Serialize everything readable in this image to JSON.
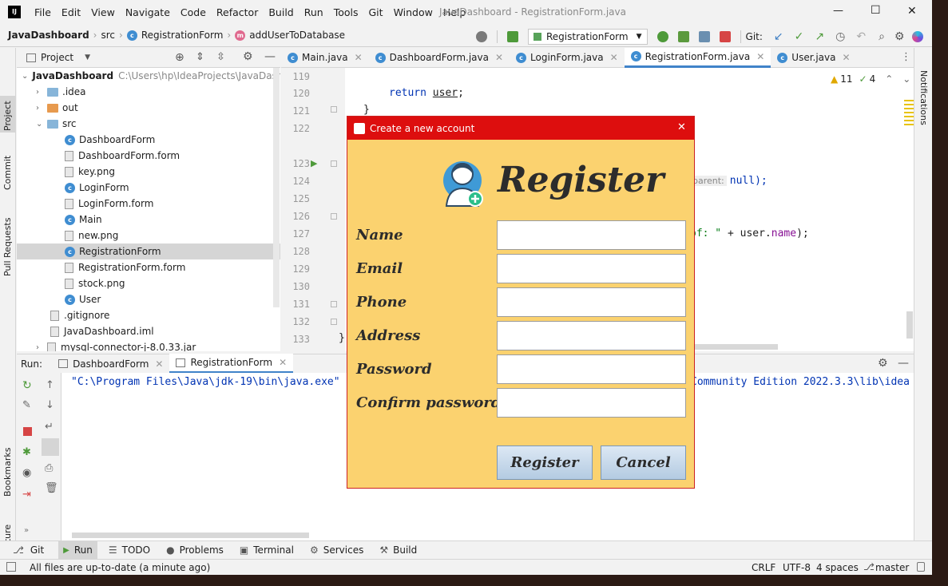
{
  "window": {
    "title": "JavaDashboard - RegistrationForm.java",
    "logo_text": "IJ",
    "menu": [
      "File",
      "Edit",
      "View",
      "Navigate",
      "Code",
      "Refactor",
      "Build",
      "Run",
      "Tools",
      "Git",
      "Window",
      "Help"
    ],
    "minimize": "—",
    "maximize": "☐",
    "close": "✕"
  },
  "breadcrumb": {
    "project": "JavaDashboard",
    "folder": "src",
    "class": "RegistrationForm",
    "method": "addUserToDatabase"
  },
  "toolbar": {
    "run_config": "RegistrationForm",
    "git_label": "Git:"
  },
  "project_panel": {
    "title": "Project",
    "root": "JavaDashboard",
    "root_path": "C:\\Users\\hp\\IdeaProjects\\JavaDashbo",
    "items": [
      ".idea",
      "out",
      "src",
      "DashboardForm",
      "DashboardForm.form",
      "key.png",
      "LoginForm",
      "LoginForm.form",
      "Main",
      "new.png",
      "RegistrationForm",
      "RegistrationForm.form",
      "stock.png",
      "User",
      ".gitignore",
      "JavaDashboard.iml",
      "mysql-connector-j-8.0.33.jar"
    ]
  },
  "left_stripe": [
    "Project",
    "Commit",
    "Pull Requests",
    "Bookmarks",
    "Structure"
  ],
  "right_stripe": [
    "Notifications"
  ],
  "editor_tabs": [
    "Main.java",
    "DashboardForm.java",
    "LoginForm.java",
    "RegistrationForm.java",
    "User.java"
  ],
  "inspections": {
    "warnings": "11",
    "weak": "4"
  },
  "gutter_lines": [
    "119",
    "120",
    "121",
    "122",
    "123",
    "124",
    "125",
    "126",
    "127",
    "128",
    "129",
    "130",
    "131",
    "132",
    "133"
  ],
  "code": {
    "return_kw": "return",
    "return_var": "user",
    "return_end": ";",
    "brace1": "}",
    "hint": "parent:",
    "null_part": "null);",
    "line127_str": "of: \"",
    "line127_plus": " + user.",
    "line127_field": "name",
    "line127_end": ");",
    "brace2": "}"
  },
  "run_panel": {
    "label": "Run:",
    "tabs": [
      "DashboardForm",
      "RegistrationForm"
    ],
    "console_left": "\"C:\\Program Files\\Java\\jdk-19\\bin\\java.exe\"",
    "console_right": "Community Edition 2022.3.3\\lib\\idea"
  },
  "tool_windows": [
    "Git",
    "Run",
    "TODO",
    "Problems",
    "Terminal",
    "Services",
    "Build"
  ],
  "status": {
    "message": "All files are up-to-date (a minute ago)",
    "line_sep": "CRLF",
    "encoding": "UTF-8",
    "indent": "4 spaces",
    "branch": "master"
  },
  "dialog": {
    "title": "Create a new account",
    "heading": "Register",
    "fields": [
      {
        "label": "Name",
        "value": ""
      },
      {
        "label": "Email",
        "value": ""
      },
      {
        "label": "Phone",
        "value": ""
      },
      {
        "label": "Address",
        "value": ""
      },
      {
        "label": "Password",
        "value": ""
      },
      {
        "label": "Confirm password",
        "value": ""
      }
    ],
    "register_button": "Register",
    "cancel_button": "Cancel",
    "close": "✕"
  },
  "colors": {
    "dialog_bg": "#fbd26f",
    "dialog_title_bg": "#dd0e0e",
    "accent": "#4083c9"
  }
}
